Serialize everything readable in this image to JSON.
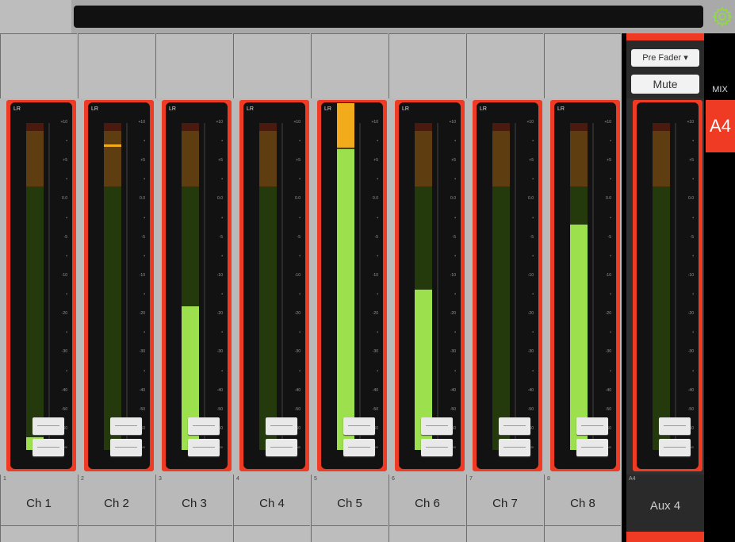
{
  "header": {
    "title": "",
    "settings_icon": "gear-icon",
    "accent_color": "#ef3a24",
    "settings_icon_color": "#8fdc3f"
  },
  "channels": [
    {
      "number": "1",
      "name": "Ch 1",
      "route_label": "LR",
      "fader_db": "-∞",
      "level": 0.04,
      "peak": null
    },
    {
      "number": "2",
      "name": "Ch 2",
      "route_label": "LR",
      "fader_db": "-∞",
      "level": 0.0,
      "peak": 0.935
    },
    {
      "number": "3",
      "name": "Ch 3",
      "route_label": "LR",
      "fader_db": "-∞",
      "level": 0.44,
      "peak": null
    },
    {
      "number": "4",
      "name": "Ch 4",
      "route_label": "LR",
      "fader_db": "-∞",
      "level": 0.0,
      "peak": null
    },
    {
      "number": "5",
      "name": "Ch 5",
      "route_label": "LR",
      "fader_db": "-∞",
      "level": 0.92,
      "peak": null
    },
    {
      "number": "6",
      "name": "Ch 6",
      "route_label": "LR",
      "fader_db": "-∞",
      "level": 0.49,
      "peak": null
    },
    {
      "number": "7",
      "name": "Ch 7",
      "route_label": "LR",
      "fader_db": "-∞",
      "level": 0.0,
      "peak": null
    },
    {
      "number": "8",
      "name": "Ch 8",
      "route_label": "LR",
      "fader_db": "-∞",
      "level": 0.69,
      "peak": null
    }
  ],
  "aux": {
    "number": "A4",
    "name": "Aux 4",
    "pre_fader_label": "Pre Fader ▾",
    "mute_label": "Mute",
    "level": 0.0
  },
  "scale_ticks": [
    "+10",
    "•",
    "+5",
    "•",
    "0.0",
    "•",
    "-5",
    "•",
    "-10",
    "•",
    "-20",
    "•",
    "-30",
    "•",
    "-40",
    "-50",
    "-60",
    "-∞"
  ],
  "mix_panel": {
    "label": "MIX",
    "selected_mix": "A4"
  }
}
